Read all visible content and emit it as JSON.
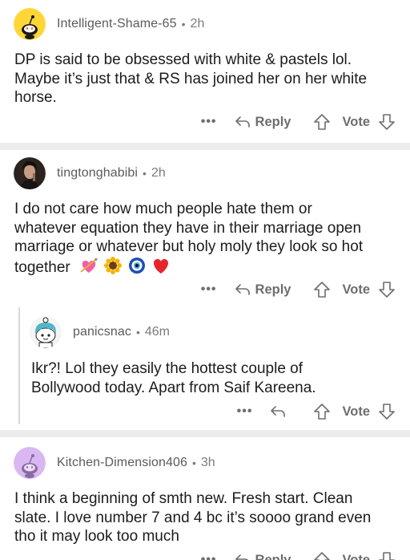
{
  "comments": [
    {
      "author": "Intelligent-Shame-65",
      "time": "2h",
      "lines": [
        "DP is said to be obsessed with white & pastels lol.",
        "Maybe it’s just that & RS has joined her on her white",
        "horse."
      ],
      "actions": {
        "more": "•••",
        "reply": "Reply",
        "vote": "Vote"
      },
      "avatar": "snoo-yellow-avatar"
    },
    {
      "author": "tingtonghabibi",
      "time": "2h",
      "lines": [
        "I do not care how much people hate them or",
        "whatever equation they have in their marriage open",
        "marriage or whatever but holy moly  they look so hot",
        "together"
      ],
      "emojis": [
        "heart-with-arrow-emoji",
        "sunflower-emoji",
        "nazar-amulet-emoji",
        "red-heart-emoji"
      ],
      "actions": {
        "more": "•••",
        "reply": "Reply",
        "vote": "Vote"
      },
      "avatar": "photo-avatar"
    },
    {
      "author": "panicsnac",
      "time": "46m",
      "lines": [
        "Ikr?! Lol they easily the hottest couple of",
        "Bollywood today. Apart from Saif Kareena."
      ],
      "actions": {
        "more": "•••",
        "vote": "Vote"
      },
      "avatar": "snoo-teal-hair-avatar"
    },
    {
      "author": "Kitchen-Dimension406",
      "time": "3h",
      "lines": [
        "I think a beginning of smth new. Fresh start. Clean",
        "slate. I love number 7 and 4 bc it’s soooo grand even",
        "tho it may look too much"
      ],
      "actions": {
        "more": "•••",
        "reply": "Reply",
        "vote": "Vote"
      },
      "avatar": "snoo-purple-avatar"
    }
  ],
  "colors": {
    "separator": "#ececec",
    "meta": "#7c7c7c",
    "action": "#6e6e6e"
  },
  "separator_dot": "•"
}
